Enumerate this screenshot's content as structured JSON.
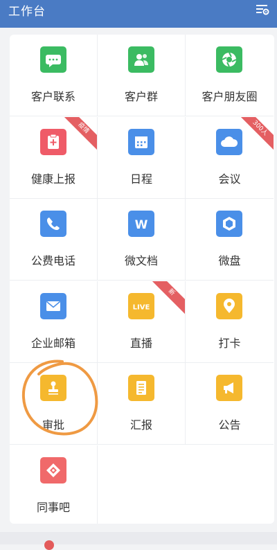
{
  "header": {
    "title": "工作台"
  },
  "apps": [
    {
      "label": "客户联系",
      "color": "#3bbb62",
      "icon": "chat-bubble-icon"
    },
    {
      "label": "客户群",
      "color": "#3bbb62",
      "icon": "contacts-icon"
    },
    {
      "label": "客户朋友圈",
      "color": "#3bbb62",
      "icon": "camera-shutter-icon"
    },
    {
      "label": "健康上报",
      "color": "#ef5b68",
      "icon": "clipboard-plus-icon",
      "badge": "疫情"
    },
    {
      "label": "日程",
      "color": "#4a8fe8",
      "icon": "calendar-icon"
    },
    {
      "label": "会议",
      "color": "#4a8fe8",
      "icon": "cloud-icon",
      "badge": "300人"
    },
    {
      "label": "公费电话",
      "color": "#4a8fe8",
      "icon": "phone-icon"
    },
    {
      "label": "微文档",
      "color": "#4a8fe8",
      "icon": "document-w-icon"
    },
    {
      "label": "微盘",
      "color": "#4a8fe8",
      "icon": "drive-icon"
    },
    {
      "label": "企业邮箱",
      "color": "#4a8fe8",
      "icon": "mail-icon"
    },
    {
      "label": "直播",
      "color": "#f5b82e",
      "icon": "live-icon",
      "badge": "新",
      "tile_text": "LIVE"
    },
    {
      "label": "打卡",
      "color": "#f5b82e",
      "icon": "location-pin-icon"
    },
    {
      "label": "审批",
      "color": "#f5b82e",
      "icon": "stamp-icon"
    },
    {
      "label": "汇报",
      "color": "#f5b82e",
      "icon": "report-icon"
    },
    {
      "label": "公告",
      "color": "#f5b82e",
      "icon": "megaphone-icon"
    },
    {
      "label": "同事吧",
      "color": "#f0696a",
      "icon": "diamond-icon"
    }
  ],
  "annotation_color": "#ef9a43"
}
